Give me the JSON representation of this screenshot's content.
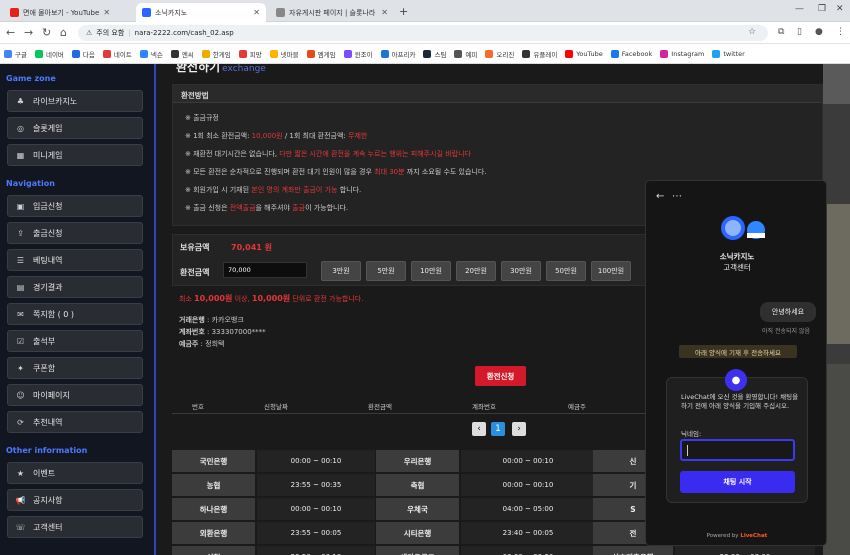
{
  "browser": {
    "tabs": [
      {
        "title": "면애 몰아보기 - YouTube",
        "color": "#e62117"
      },
      {
        "title": "소닉카지노",
        "color": "#2b66ff"
      },
      {
        "title": "자유게시판 페이지 | 슬롯나라",
        "color": "#888888"
      }
    ],
    "new_tab": "+",
    "security": "주의 요함",
    "url": "nara-2222.com/cash_02.asp",
    "bookmarks": [
      {
        "label": "구글",
        "color": "#4285f4"
      },
      {
        "label": "네이버",
        "color": "#03c75a"
      },
      {
        "label": "다음",
        "color": "#1e6be5"
      },
      {
        "label": "네이트",
        "color": "#e5383b"
      },
      {
        "label": "넥슨",
        "color": "#2c87ff"
      },
      {
        "label": "엔씨",
        "color": "#333333"
      },
      {
        "label": "한게임",
        "color": "#f2a900"
      },
      {
        "label": "피망",
        "color": "#e53935"
      },
      {
        "label": "넷마블",
        "color": "#ffb300"
      },
      {
        "label": "엠게임",
        "color": "#e64a19"
      },
      {
        "label": "윈조이",
        "color": "#7c4dff"
      },
      {
        "label": "아프리카",
        "color": "#1976d2"
      },
      {
        "label": "스팀",
        "color": "#1b2838"
      },
      {
        "label": "예피",
        "color": "#555555"
      },
      {
        "label": "오리진",
        "color": "#f56c2d"
      },
      {
        "label": "유플레이",
        "color": "#333333"
      },
      {
        "label": "YouTube",
        "color": "#ff0000"
      },
      {
        "label": "Facebook",
        "color": "#1877f2"
      },
      {
        "label": "Instagram",
        "color": "#d6249f"
      },
      {
        "label": "twitter",
        "color": "#1da1f2"
      }
    ]
  },
  "sidebar": {
    "sections": [
      {
        "title": "Game zone",
        "items": [
          "라이브카지노",
          "슬롯게임",
          "미니게임"
        ]
      },
      {
        "title": "Navigation",
        "items": [
          "입금신청",
          "출금신청",
          "베팅내역",
          "경기결과",
          "쪽지함 ( 0 )",
          "출석부",
          "쿠폰함",
          "마이페이지",
          "추천내역"
        ]
      },
      {
        "title": "Other information",
        "items": [
          "이벤트",
          "공지사항",
          "고객센터"
        ]
      }
    ]
  },
  "main": {
    "title": "환전하기",
    "title_en": "exchange",
    "rules_head": "환전방법",
    "rules": [
      [
        {
          "t": "※ 출금규정"
        }
      ],
      [
        {
          "t": "※ 1회 최소 환전금액: "
        },
        {
          "t": "10,000원",
          "red": true
        },
        {
          "t": " / 1회 최대 환전금액: "
        },
        {
          "t": "무제한",
          "red": true
        }
      ],
      [
        {
          "t": "※ 재환전 대기시간은 없습니다, "
        },
        {
          "t": "다만 짧은 시간에 환전을 계속 누르는 행위는 피해주시길 바랍니다",
          "red": true
        }
      ],
      [
        {
          "t": "※ 모든 환전은 순차적으로 진행되며 환전 대기 인원이 많을 경우 "
        },
        {
          "t": "최대 30분",
          "red": true
        },
        {
          "t": " 까지 소요될 수도 있습니다."
        }
      ],
      [
        {
          "t": "※ 회원가입 시 기재된 "
        },
        {
          "t": "본인 명의 계좌만 출금이 가능",
          "red": true
        },
        {
          "t": " 합니다."
        }
      ],
      [
        {
          "t": "※ 출금 신청은 "
        },
        {
          "t": "전액출금",
          "red": true
        },
        {
          "t": "을 해주셔야 "
        },
        {
          "t": "출금",
          "red": true
        },
        {
          "t": "이 가능합니다."
        }
      ]
    ],
    "balance_label": "보유금액",
    "balance": "70,041 원",
    "amount_label": "환전금액",
    "amount_value": "70,000",
    "quick_buttons": [
      "3만원",
      "5만원",
      "10만원",
      "20만원",
      "30만원",
      "50만원",
      "100만원"
    ],
    "limit_note": [
      {
        "t": "최소 ",
        "red": true
      },
      {
        "t": "10,000원",
        "red": true,
        "b": true
      },
      {
        "t": " 이상, ",
        "red": true
      },
      {
        "t": "10,000원",
        "red": true,
        "b": true
      },
      {
        "t": " 단위로 환전 가능합니다.",
        "red": true
      }
    ],
    "bank_label": "거래은행",
    "bank_value": "카카오뱅크",
    "account_label": "계좌번호",
    "account_value": "333307000****",
    "holder_label": "예금주",
    "holder_value": "정희택",
    "submit": "환전신청",
    "table_headers": [
      "번호",
      "신청날짜",
      "환전금액",
      "계좌번호",
      "예금주"
    ],
    "pager": {
      "prev": "‹",
      "current": "1",
      "next": "›"
    },
    "bank_hours": [
      [
        {
          "n": "국민은행",
          "t": "00:00 ~ 00:10"
        },
        {
          "n": "우리은행",
          "t": "00:00 ~ 00:10"
        },
        {
          "n": "신",
          "t": ""
        }
      ],
      [
        {
          "n": "농협",
          "t": "23:55 ~ 00:35"
        },
        {
          "n": "축협",
          "t": "00:00 ~ 00:10"
        },
        {
          "n": "기",
          "t": ""
        }
      ],
      [
        {
          "n": "하나은행",
          "t": "00:00 ~ 00:10"
        },
        {
          "n": "우체국",
          "t": "04:00 ~ 05:00"
        },
        {
          "n": "S",
          "t": ""
        }
      ],
      [
        {
          "n": "외환은행",
          "t": "23:55 ~ 00:05"
        },
        {
          "n": "시티은행",
          "t": "23:40 ~ 00:05"
        },
        {
          "n": "전",
          "t": ""
        }
      ],
      [
        {
          "n": "신협",
          "t": "23:50 ~ 00:10"
        },
        {
          "n": "새마을금고",
          "t": "00:00 ~ 00:30"
        },
        {
          "n": "상호저축은행",
          "t": "23:00 ~ 08:00"
        }
      ]
    ]
  },
  "chat": {
    "name": "소닉카지노",
    "sub": "고객센터",
    "greeting": "안녕하세요",
    "unread": "아직 전송되지 않음",
    "notice": "아래 양식에 기재 후 전송하세요",
    "form_text": "LiveChat에 오신 것을 환영합니다! 채팅을 하기 전에 아래 양식을 기입해 주십시오.",
    "nickname_label": "닉네임:",
    "start_button": "채팅 시작",
    "powered_prefix": "Powered by",
    "powered_brand": "LiveChat"
  }
}
